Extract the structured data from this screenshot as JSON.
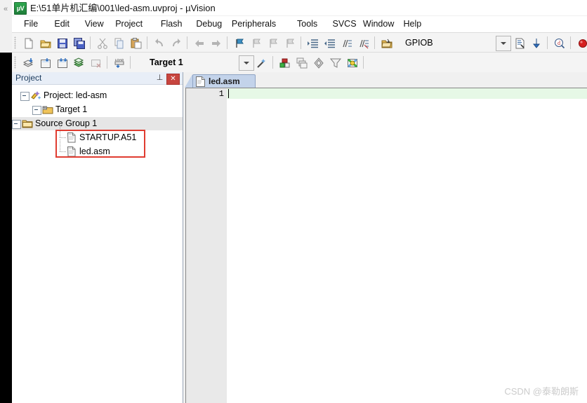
{
  "window": {
    "title": "E:\\51单片机汇编\\001\\led-asm.uvproj - µVision",
    "app_icon": "uvision-icon",
    "icon_text": "µV",
    "left_chevron": "«"
  },
  "menu": {
    "items": [
      {
        "label": "File",
        "name": "menu-file"
      },
      {
        "label": "Edit",
        "name": "menu-edit"
      },
      {
        "label": "View",
        "name": "menu-view"
      },
      {
        "label": "Project",
        "name": "menu-project"
      },
      {
        "label": "Flash",
        "name": "menu-flash"
      },
      {
        "label": "Debug",
        "name": "menu-debug"
      },
      {
        "label": "Peripherals",
        "name": "menu-peripherals"
      },
      {
        "label": "Tools",
        "name": "menu-tools"
      },
      {
        "label": "SVCS",
        "name": "menu-svcs"
      },
      {
        "label": "Window",
        "name": "menu-window"
      },
      {
        "label": "Help",
        "name": "menu-help"
      }
    ]
  },
  "toolbar_main": {
    "buttons": [
      "new-file-icon",
      "open-file-icon",
      "save-icon",
      "save-all-icon",
      "cut-icon",
      "copy-icon",
      "paste-icon",
      "undo-icon",
      "redo-icon",
      "navigate-back-icon",
      "navigate-forward-icon",
      "bookmark-toggle-icon",
      "bookmark-prev-icon",
      "bookmark-next-icon",
      "bookmark-clear-icon",
      "indent-icon",
      "outdent-icon",
      "comment-icon",
      "uncomment-icon",
      "browse-icon"
    ],
    "symbol_combo": {
      "value": "GPIOB",
      "placeholder": "GPIOB"
    },
    "right_buttons": [
      "find-in-files-icon",
      "bookmark-goto-icon",
      "debug-query-icon"
    ],
    "status_dots": [
      "record-dot-red",
      "record-dot-gray"
    ]
  },
  "toolbar_build": {
    "buttons": [
      "translate-icon",
      "build-icon",
      "rebuild-all-icon",
      "batch-build-icon",
      "stop-build-icon",
      "download-icon"
    ],
    "target_select": {
      "value": "Target 1"
    },
    "right_buttons": [
      "options-wizard-icon",
      "target-options-icon",
      "manage-components-icon",
      "multi-project-icon",
      "filter-icon",
      "books-icon"
    ]
  },
  "project_panel": {
    "title": "Project",
    "pin_icon": "pin-icon",
    "pin_glyph": "⊥",
    "close_icon": "close-icon",
    "close_glyph": "✕",
    "tree": [
      {
        "label": "Project: led-asm",
        "name": "tree-node-project",
        "icon": "project-icon",
        "depth": 0,
        "selected": false,
        "expander": true
      },
      {
        "label": "Target 1",
        "name": "tree-node-target",
        "icon": "target-icon",
        "depth": 1,
        "selected": false,
        "expander": true
      },
      {
        "label": "Source Group 1",
        "name": "tree-node-source-group",
        "icon": "folder-icon",
        "depth": 2,
        "selected": true,
        "expander": true
      },
      {
        "label": "STARTUP.A51",
        "name": "tree-node-startup-a51",
        "icon": "document-icon",
        "depth": 3,
        "selected": false,
        "expander": false
      },
      {
        "label": "led.asm",
        "name": "tree-node-led-asm",
        "icon": "document-icon",
        "depth": 3,
        "selected": false,
        "expander": false
      }
    ],
    "annotation_color": "#e03c31"
  },
  "editor": {
    "tabs": [
      {
        "label": "led.asm",
        "name": "editor-tab-led-asm",
        "active": true,
        "icon": "document-icon"
      }
    ],
    "line_numbers": [
      "1"
    ],
    "lines": [
      ""
    ],
    "current_line_color": "#e6f8e6"
  },
  "watermark": {
    "text": "CSDN @泰勒朗斯"
  }
}
